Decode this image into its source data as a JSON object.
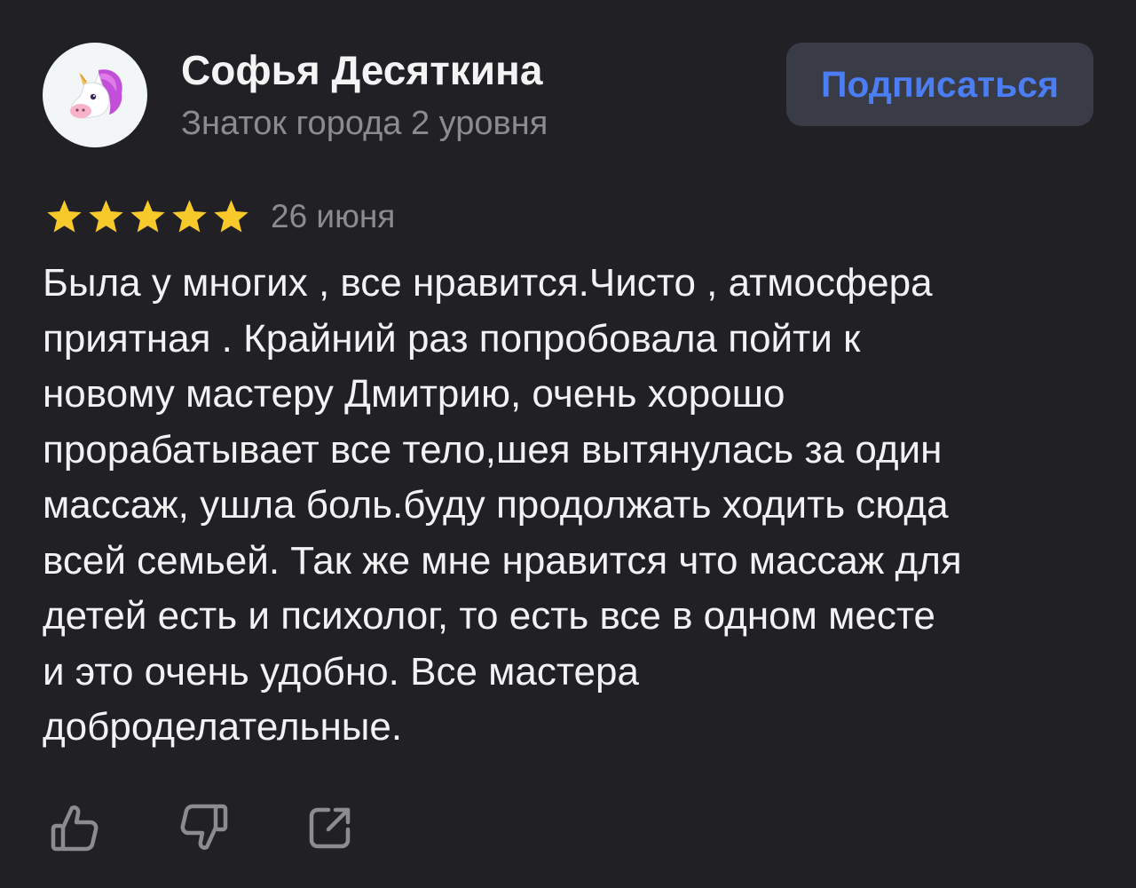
{
  "author": {
    "avatar_icon": "unicorn-icon",
    "name": "Софья Десяткина",
    "level": "Знаток города 2 уровня"
  },
  "subscribe": {
    "label": "Подписаться",
    "color": "#4b7df5",
    "background": "#393b46"
  },
  "rating": {
    "stars": 5,
    "max": 5,
    "star_color": "#f8c92b"
  },
  "date": "26 июня",
  "review_text": "Была у многих , все нравится.Чисто , атмосфера\nприятная . Крайний раз попробовала пойти к\nновому мастеру Дмитрию, очень хорошо\nпрорабатывает все тело,шея вытянулась за один\nмассаж, ушла боль.буду продолжать ходить сюда\nвсей семьей. Так же мне нравится что массаж для\nдетей есть и психолог, то есть все в одном месте\nи это очень удобно. Все мастера\nдоброделательные.",
  "actions": [
    {
      "icon": "thumbs-up-icon"
    },
    {
      "icon": "thumbs-down-icon"
    },
    {
      "icon": "share-icon"
    }
  ],
  "colors": {
    "background": "#212125",
    "secondary_text": "#8b8b90",
    "icon": "#8b8b90"
  }
}
